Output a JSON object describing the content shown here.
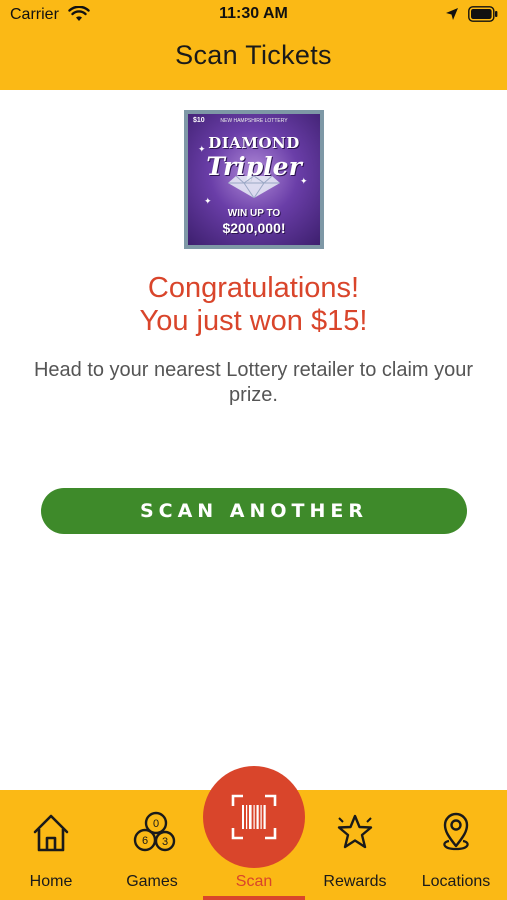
{
  "status_bar": {
    "carrier": "Carrier",
    "time": "11:30 AM"
  },
  "header": {
    "title": "Scan Tickets"
  },
  "ticket": {
    "price": "$10",
    "brand": "NEW HAMPSHIRE LOTTERY",
    "name_line1": "DIAMOND",
    "name_line2": "Tripler",
    "prize_line1": "WIN UP TO",
    "prize_line2": "$200,000!"
  },
  "result": {
    "line1": "Congratulations!",
    "line2": "You just won $15!",
    "info": "Head to your nearest Lottery retailer to claim your prize."
  },
  "actions": {
    "scan_another": "SCAN ANOTHER"
  },
  "tabs": [
    {
      "label": "Home",
      "icon": "home-icon"
    },
    {
      "label": "Games",
      "icon": "lottery-balls-icon"
    },
    {
      "label": "Scan",
      "icon": "barcode-scan-icon",
      "active": true
    },
    {
      "label": "Rewards",
      "icon": "star-icon"
    },
    {
      "label": "Locations",
      "icon": "map-pin-icon"
    }
  ],
  "colors": {
    "brand_yellow": "#FBB915",
    "accent_red": "#D9452B",
    "button_green": "#3E8A2A"
  }
}
